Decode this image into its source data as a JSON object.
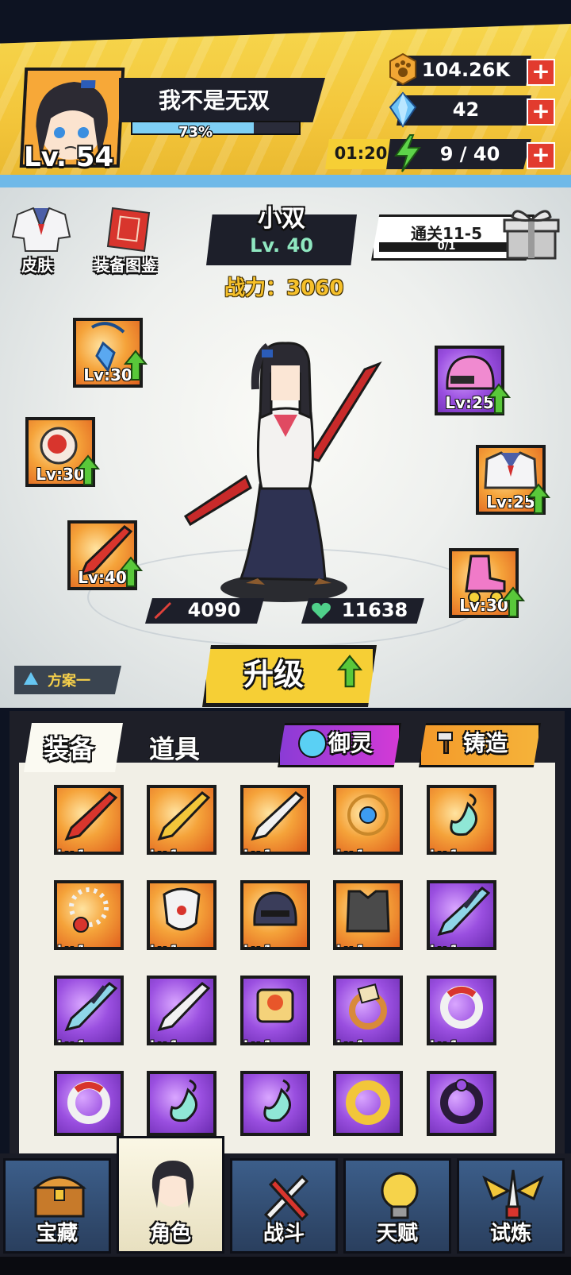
{
  "player": {
    "name": "我不是无双",
    "level_label": "Lv. 54",
    "xp_percent_label": "73%",
    "xp_fraction": 0.73
  },
  "resources": {
    "coins": "104.26K",
    "gems": "42",
    "energy_timer": "01:20",
    "energy": "9 / 40"
  },
  "side_buttons": {
    "skin": "皮肤",
    "codex": "装备图鉴"
  },
  "character": {
    "name": "小双",
    "level": "Lv. 40",
    "power": "战力：3060"
  },
  "quest": {
    "title": "通关11-5",
    "progress": "0/1",
    "progress_fraction": 0
  },
  "equipped": {
    "left": [
      "Lv:30",
      "Lv:30",
      "Lv:40"
    ],
    "right": [
      "Lv:25",
      "Lv:25",
      "Lv:30"
    ]
  },
  "stats": {
    "attack": "4090",
    "hp": "11638"
  },
  "upgrade_label": "升级",
  "scheme_label": "方案一",
  "tabs": {
    "equipment": "装备",
    "items": "道具"
  },
  "actions": {
    "yuling": "御灵",
    "zhuzao": "铸造"
  },
  "inventory": [
    {
      "lv": "Lv.1",
      "bg": "orange",
      "icon": "red-sword-icon"
    },
    {
      "lv": "Lv.1",
      "bg": "orange",
      "icon": "golden-blade-icon"
    },
    {
      "lv": "Lv.1",
      "bg": "orange",
      "icon": "white-sword-icon"
    },
    {
      "lv": "Lv.1",
      "bg": "orange",
      "icon": "blue-gem-necklace-icon"
    },
    {
      "lv": "Lv.1",
      "bg": "orange",
      "icon": "jade-pendant-icon"
    },
    {
      "lv": "Lv.1",
      "bg": "orange",
      "icon": "bead-necklace-icon"
    },
    {
      "lv": "Lv.1",
      "bg": "orange",
      "icon": "white-mask-icon"
    },
    {
      "lv": "Lv.1",
      "bg": "orange",
      "icon": "helmet-icon"
    },
    {
      "lv": "Lv.1",
      "bg": "orange",
      "icon": "armor-vest-icon"
    },
    {
      "lv": "Lv.1",
      "bg": "purple",
      "icon": "dark-blade-icon"
    },
    {
      "lv": "Lv.1",
      "bg": "purple",
      "icon": "dark-blade-icon"
    },
    {
      "lv": "Lv.1",
      "bg": "purple",
      "icon": "white-sword-icon"
    },
    {
      "lv": "Lv.1",
      "bg": "purple",
      "icon": "scroll-icon"
    },
    {
      "lv": "Lv.1",
      "bg": "purple",
      "icon": "ring-icon"
    },
    {
      "lv": "Lv.1",
      "bg": "purple",
      "icon": "red-ring-icon"
    },
    {
      "lv": "",
      "bg": "purple",
      "icon": "red-ring-icon"
    },
    {
      "lv": "",
      "bg": "purple",
      "icon": "jade-pendant-icon"
    },
    {
      "lv": "",
      "bg": "purple",
      "icon": "jade-pendant-icon"
    },
    {
      "lv": "",
      "bg": "purple",
      "icon": "gold-ring-icon"
    },
    {
      "lv": "",
      "bg": "purple",
      "icon": "dark-ring-icon"
    }
  ],
  "nav": [
    {
      "label": "宝藏",
      "icon": "treasure-chest-icon",
      "active": false
    },
    {
      "label": "角色",
      "icon": "character-portrait-icon",
      "active": true
    },
    {
      "label": "战斗",
      "icon": "crossed-swords-icon",
      "active": false
    },
    {
      "label": "天赋",
      "icon": "lightbulb-icon",
      "active": false
    },
    {
      "label": "试炼",
      "icon": "winged-sword-icon",
      "active": false
    }
  ],
  "colors": {
    "accent_yellow": "#f6cf35",
    "dark_panel": "#1d1f2a",
    "sky_blue": "#7fd0f4",
    "upgrade_green": "#59c83a",
    "plus_red": "#e23b2e"
  }
}
